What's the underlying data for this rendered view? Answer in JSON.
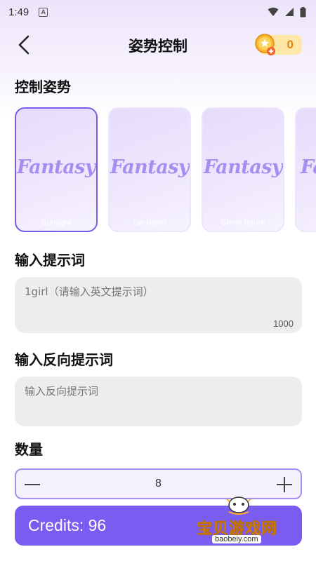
{
  "status_bar": {
    "time": "1:49",
    "app_indicator": "A"
  },
  "header": {
    "title": "姿势控制",
    "back_icon": "chevron-left-icon",
    "coin_count": "0"
  },
  "pose_section": {
    "label": "控制姿势",
    "cards": [
      {
        "art_text": "Fantasy",
        "label": "Sunlight",
        "selected": true
      },
      {
        "art_text": "Fantasy",
        "label": "Lie down",
        "selected": false
      },
      {
        "art_text": "Fantasy",
        "label": "Show figure",
        "selected": false
      },
      {
        "art_text": "Fa",
        "label": "",
        "selected": false
      }
    ]
  },
  "prompt_section": {
    "label": "输入提示词",
    "placeholder": "1girl（请输入英文提示词）",
    "max_length": "1000"
  },
  "negative_prompt_section": {
    "label": "输入反向提示词",
    "placeholder": "输入反向提示词"
  },
  "quantity_section": {
    "label": "数量",
    "value": "8"
  },
  "credits_button": {
    "label": "Credits: 96"
  },
  "watermark": {
    "title": "宝贝游戏网",
    "url": "baobeiy.com"
  },
  "colors": {
    "accent": "#7a5cf0",
    "coin_bg": "#ffe7a8",
    "input_bg": "#ededed"
  }
}
